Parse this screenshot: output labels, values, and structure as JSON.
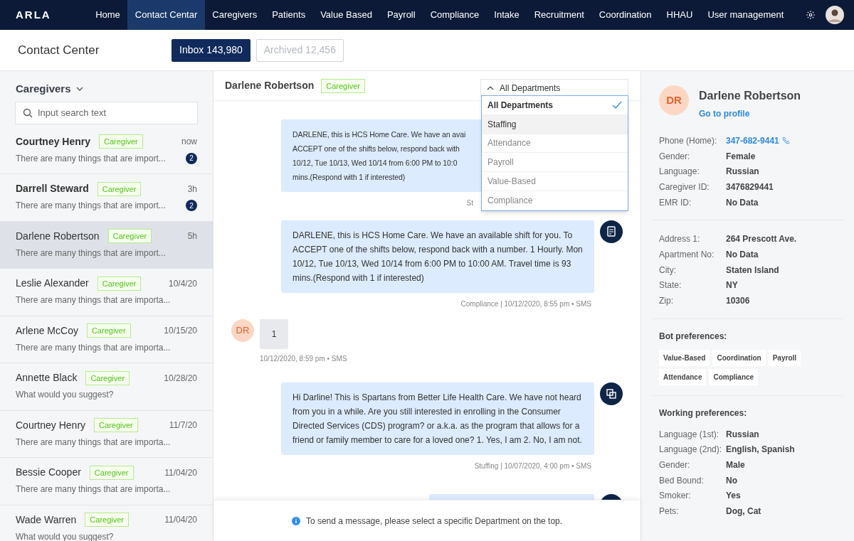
{
  "nav": {
    "brand": "ARLA",
    "items": [
      {
        "label": "Home",
        "selected": false
      },
      {
        "label": "Contact Centar",
        "selected": true
      },
      {
        "label": "Caregivers",
        "selected": false
      },
      {
        "label": "Patients",
        "selected": false
      },
      {
        "label": "Value Based",
        "selected": false
      },
      {
        "label": "Payroll",
        "selected": false
      },
      {
        "label": "Compliance",
        "selected": false
      },
      {
        "label": "Intake",
        "selected": false
      },
      {
        "label": "Recruitment",
        "selected": false
      },
      {
        "label": "Coordination",
        "selected": false
      },
      {
        "label": "HHAU",
        "selected": false
      },
      {
        "label": "User management",
        "selected": false
      }
    ]
  },
  "header": {
    "title": "Contact Center",
    "tabs": [
      {
        "label": "Inbox 143,980",
        "selected": true
      },
      {
        "label": "Archived 12,456",
        "selected": false
      }
    ]
  },
  "list": {
    "title": "Caregivers",
    "search": {
      "placeholder": "Input search text"
    },
    "conversations": [
      {
        "name": "Courtney Henry",
        "tag": "Caregiver",
        "time": "now",
        "preview": "There are many things that are import...",
        "badge": "2",
        "selected": false
      },
      {
        "name": "Darrell Steward",
        "tag": "Caregiver",
        "time": "3h",
        "preview": "There are many things that are import...",
        "badge": "2",
        "selected": false
      },
      {
        "name": "Darlene Robertson",
        "tag": "Caregiver",
        "time": "5h",
        "preview": "There are many things that are import...",
        "selected": true
      },
      {
        "name": "Leslie Alexander",
        "tag": "Caregiver",
        "time": "10/4/20",
        "preview": "There are many things that are importa...",
        "selected": false
      },
      {
        "name": "Arlene McCoy",
        "tag": "Caregiver",
        "time": "10/15/20",
        "preview": "There are many things that are importa...",
        "selected": false
      },
      {
        "name": "Annette Black",
        "tag": "Caregiver",
        "time": "10/28/20",
        "preview": "What would you suggest?",
        "selected": false
      },
      {
        "name": "Courtney Henry",
        "tag": "Caregiver",
        "time": "11/7/20",
        "preview": "There are many things that are importa...",
        "selected": false
      },
      {
        "name": "Bessie Cooper",
        "tag": "Caregiver",
        "time": "11/04/20",
        "preview": "There are many things that are importa...",
        "selected": false
      },
      {
        "name": "Wade Warren",
        "tag": "Caregiver",
        "time": "11/04/20",
        "preview": "What would you suggest?",
        "selected": false
      }
    ]
  },
  "chat": {
    "name": "Darlene Robertson",
    "tag": "Caregiver",
    "department": {
      "value": "All Departments",
      "expanded": true,
      "options": [
        {
          "label": "All Departments",
          "selected": true,
          "highlighted": false
        },
        {
          "label": "Staffing",
          "selected": false,
          "highlighted": true
        },
        {
          "label": "Attendance",
          "selected": false,
          "highlighted": false
        },
        {
          "label": "Payroll",
          "selected": false,
          "highlighted": false
        },
        {
          "label": "Value-Based",
          "selected": false,
          "highlighted": false
        },
        {
          "label": "Compliance",
          "selected": false,
          "highlighted": false
        }
      ]
    },
    "messages": [
      {
        "kind": "outgoing",
        "lines": [
          "DARLENE, this is HCS Home Care. We have an avai",
          "ACCEPT one of the shifts below, respond back with",
          "10/12, Tue 10/13, Wed 10/14 from 6:00 PM to 10:0",
          "mins.(Respond with 1 if interested)"
        ],
        "meta": "St"
      },
      {
        "kind": "document",
        "text": "DARLENE, this is HCS Home Care. We have an available shift for you. To ACCEPT one of the shifts below, respond back with a number. 1 Hourly. Mon 10/12, Tue 10/13, Wed 10/14 from 6:00 PM to 10:00 AM. Travel time is 93 mins.(Respond with 1 if interested)",
        "meta": "Compliance | 10/12/2020, 8:55 pm • SMS"
      },
      {
        "kind": "incoming",
        "avatar": "DR",
        "text": "1",
        "meta": "10/12/2020, 8:59 pm • SMS"
      },
      {
        "kind": "copy",
        "text": "Hi Darline! This is Spartans from Better Life Health Care. We have not heard from you in a while. Are you still interested in enrolling in the Consumer Directed Services (CDS) program? or a.k.a. as the program that allows for a friend or family member to care for a loved one? 1. Yes, I am 2. No, I am not.",
        "meta": "Stuffing | 10/07/2020, 4:00 pm • SMS"
      },
      {
        "kind": "cut"
      }
    ],
    "notice": "To send a message, please select a specific Department on the top."
  },
  "profile": {
    "initials": "DR",
    "name": "Darlene Robertson",
    "link": "Go to profile",
    "sections": [
      {
        "fields": [
          {
            "label": "Phone (Home):",
            "value": "347-682-9441",
            "kind": "phone"
          },
          {
            "label": "Gender:",
            "value": "Female",
            "kind": "text"
          },
          {
            "label": "Language:",
            "value": "Russian",
            "kind": "text"
          },
          {
            "label": "Caregiver ID:",
            "value": "3476829441",
            "kind": "text"
          },
          {
            "label": "EMR ID:",
            "value": "No Data",
            "kind": "text"
          }
        ]
      },
      {
        "fields": [
          {
            "label": "Address 1:",
            "value": "264 Prescott Ave.",
            "kind": "text"
          },
          {
            "label": "Apartment No:",
            "value": "No Data",
            "kind": "text"
          },
          {
            "label": "City:",
            "value": "Staten Island",
            "kind": "text"
          },
          {
            "label": "State:",
            "value": "NY",
            "kind": "text"
          },
          {
            "label": "Zip:",
            "value": "10306",
            "kind": "text"
          }
        ]
      },
      {
        "title": "Bot preferences:",
        "chips": [
          "Value-Based",
          "Coordination",
          "Payroll",
          "Attendance",
          "Compliance"
        ]
      },
      {
        "title": "Working preferences:",
        "fields": [
          {
            "label": "Language (1st):",
            "value": "Russian",
            "kind": "text"
          },
          {
            "label": "Language (2nd):",
            "value": "English, Spanish",
            "kind": "text"
          },
          {
            "label": "Gender:",
            "value": "Male",
            "kind": "text"
          },
          {
            "label": "Bed Bound:",
            "value": "No",
            "kind": "text"
          },
          {
            "label": "Smoker:",
            "value": "Yes",
            "kind": "text"
          },
          {
            "label": "Pets:",
            "value": "Dog, Cat",
            "kind": "text"
          }
        ]
      }
    ]
  }
}
